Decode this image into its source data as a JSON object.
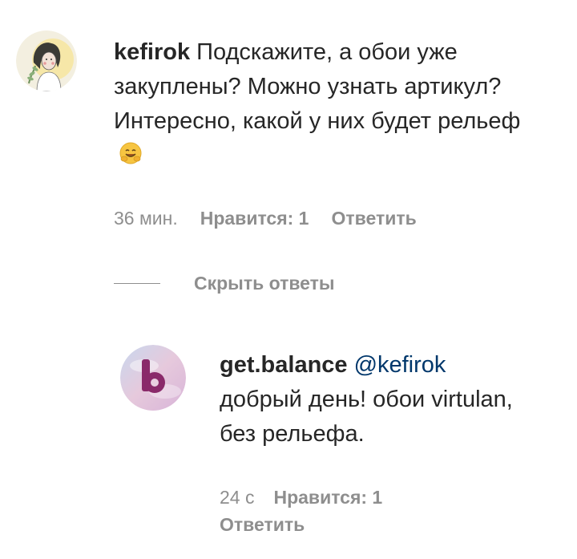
{
  "comment": {
    "avatar_icon": "user-illustration-avatar",
    "username": "kefirok",
    "text": "Подскажите, а обои уже закуплены? Можно узнать артикул? Интересно, какой у них будет рельеф",
    "emoji_icon": "hugging-face-emoji",
    "time": "36 мин.",
    "likes": "Нравится: 1",
    "reply_label": "Ответить"
  },
  "toggle": {
    "hide_replies_label": "Скрыть ответы"
  },
  "reply": {
    "avatar_icon": "b-letter-logo-avatar",
    "username": "get.balance",
    "mention": "@kefirok",
    "text": "добрый день! обои virtulan, без рельефа.",
    "time": "24 с",
    "likes": "Нравится: 1",
    "reply_label": "Ответить"
  },
  "colors": {
    "text": "#262626",
    "secondary": "#8e8e8e",
    "mention": "#00376b",
    "logo_purple": "#8a2a6a"
  }
}
